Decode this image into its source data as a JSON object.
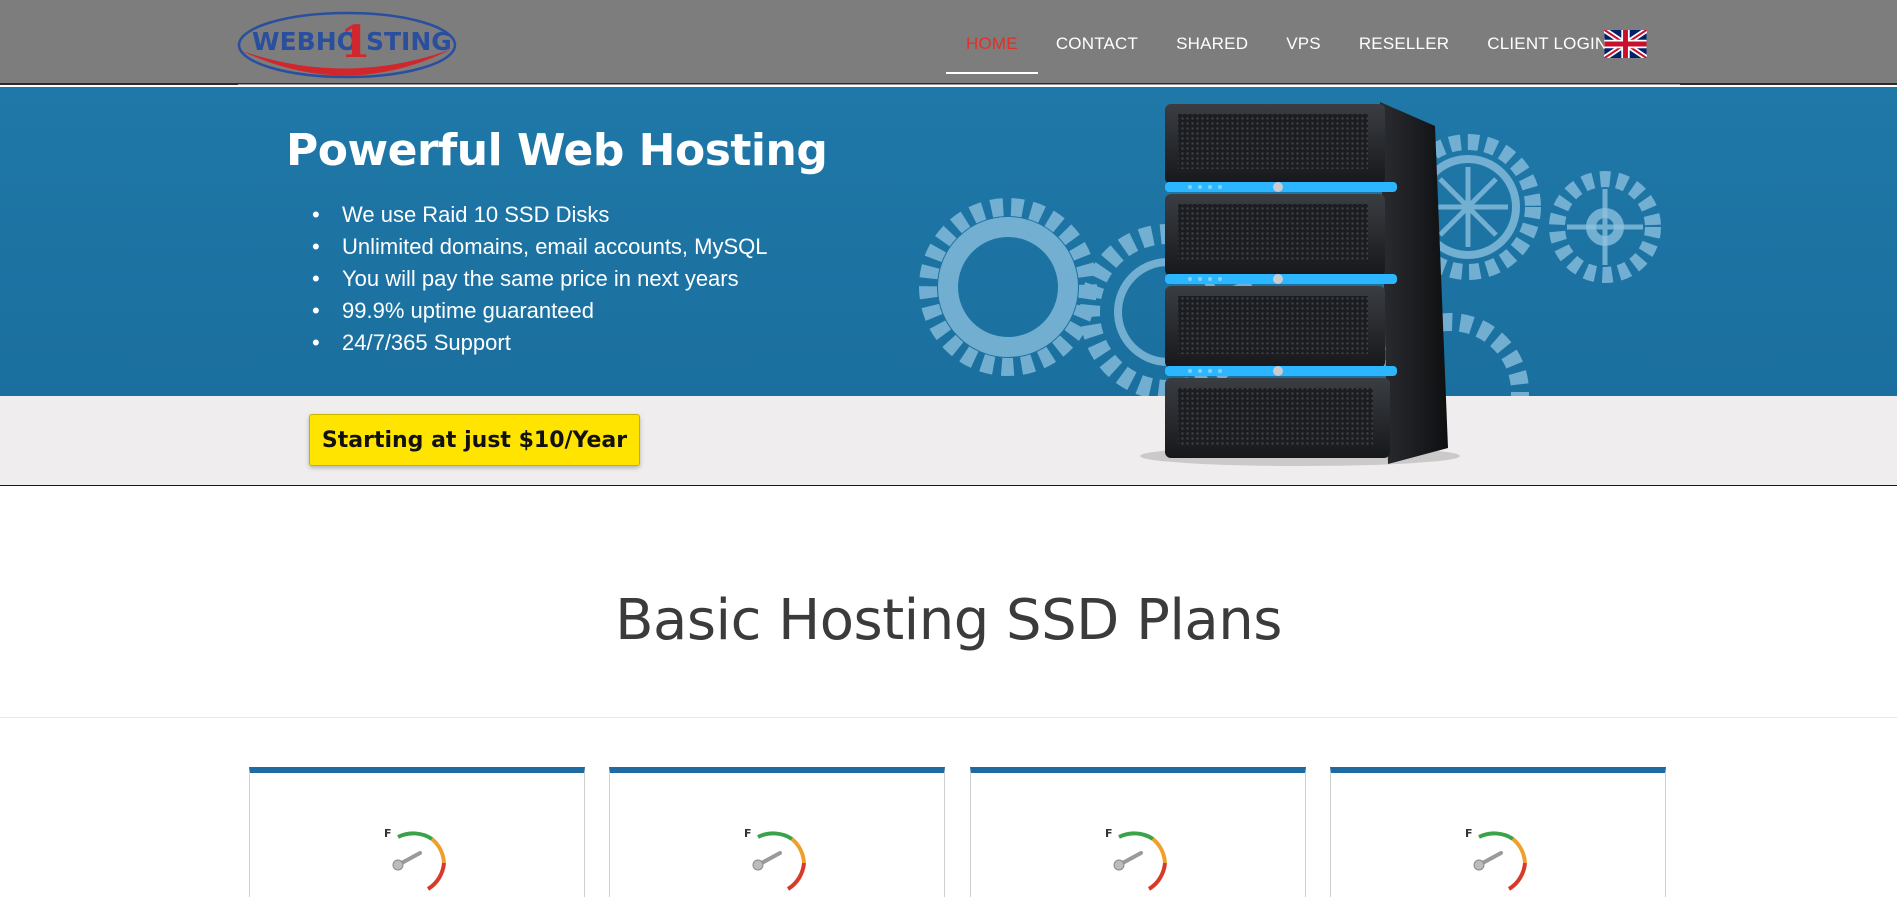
{
  "brand": {
    "logo_text": "WEBHO1STING",
    "logo_colors": {
      "text": "#2a4f9e",
      "digit": "#d1262b",
      "swoosh": "#d1262b"
    }
  },
  "nav": {
    "items": [
      {
        "label": "HOME",
        "active": true
      },
      {
        "label": "CONTACT",
        "active": false
      },
      {
        "label": "SHARED",
        "active": false
      },
      {
        "label": "VPS",
        "active": false
      },
      {
        "label": "RESELLER",
        "active": false
      },
      {
        "label": "CLIENT LOGIN",
        "active": false
      }
    ],
    "language_icon": "uk-flag-icon"
  },
  "hero": {
    "title": "Powerful Web Hosting",
    "features": [
      "We use Raid 10 SSD Disks",
      "Unlimited domains, email accounts, MySQL",
      "You will pay the same price in next years",
      "99.9% uptime guaranteed",
      "24/7/365 Support"
    ],
    "cta_label": "Starting at just $10/Year"
  },
  "plans": {
    "section_title": "Basic Hosting SSD Plans",
    "cards": [
      {
        "gauge_label": "F"
      },
      {
        "gauge_label": "F"
      },
      {
        "gauge_label": "F"
      },
      {
        "gauge_label": "F"
      }
    ]
  },
  "colors": {
    "header_bg": "#7d7d7d",
    "active_nav": "#e1302a",
    "hero_bg": "#1f78a8",
    "cta_bg": "#ffe400",
    "card_accent": "#1f6aa0"
  }
}
